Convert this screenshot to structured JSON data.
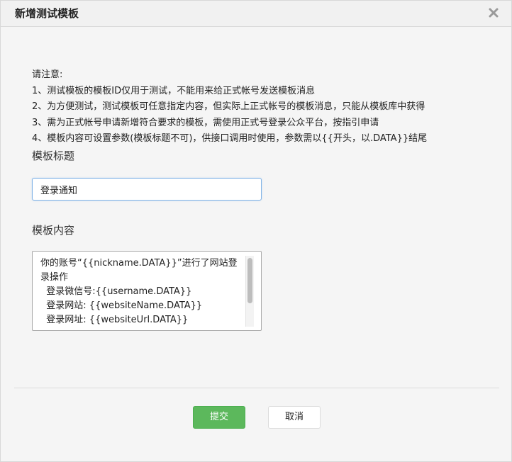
{
  "dialog": {
    "title": "新增测试模板",
    "close_icon": "close-icon"
  },
  "notice": {
    "heading": "请注意:",
    "lines": [
      "1、测试模板的模板ID仅用于测试，不能用来给正式帐号发送模板消息",
      "2、为方便测试，测试模板可任意指定内容，但实际上正式帐号的模板消息，只能从模板库中获得",
      "3、需为正式帐号申请新增符合要求的模板，需使用正式号登录公众平台，按指引申请",
      "4、模板内容可设置参数(模板标题不可)，供接口调用时使用，参数需以{{开头，以.DATA}}结尾"
    ]
  },
  "form": {
    "title_label": "模板标题",
    "title_value": "登录通知",
    "content_label": "模板内容",
    "content_value": "你的账号“{{nickname.DATA}}”进行了网站登录操作\n  登录微信号:{{username.DATA}}\n  登录网站: {{websiteName.DATA}}\n  登录网址: {{websiteUrl.DATA}}"
  },
  "buttons": {
    "submit_label": "提交",
    "cancel_label": "取消"
  },
  "colors": {
    "submit_bg": "#5cb85c",
    "input_focus_border": "#7fb2e6"
  }
}
